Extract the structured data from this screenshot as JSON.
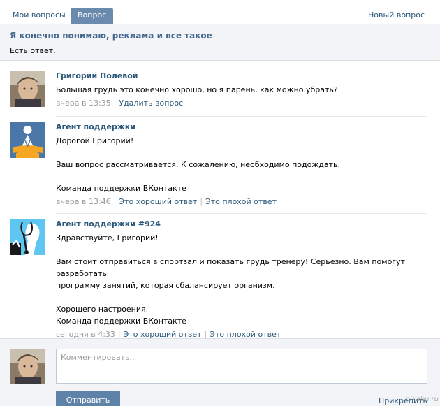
{
  "tabs": {
    "my_questions": "Мои вопросы",
    "question": "Вопрос",
    "new_question": "Новый вопрос"
  },
  "question": {
    "title": "Я конечно понимаю, реклама и все такое",
    "status": "Есть ответ."
  },
  "posts": [
    {
      "author": "Григорий Полевой",
      "lines": [
        "Большая грудь это конечно хорошо, но я парень, как можно убрать?"
      ],
      "time": "вчера в 13:35",
      "actions": [
        "Удалить вопрос"
      ]
    },
    {
      "author": "Агент поддержки",
      "lines": [
        "Дорогой Григорий!",
        "",
        "Ваш вопрос рассматривается. К сожалению, необходимо подождать.",
        "",
        "Команда поддержки ВКонтакте"
      ],
      "time": "вчера в 13:46",
      "actions": [
        "Это хороший ответ",
        "Это плохой ответ"
      ]
    },
    {
      "author": "Агент поддержки #924",
      "lines": [
        "Здравствуйте, Григорий!",
        "",
        "Вам стоит отправиться в спортзал и показать грудь тренеру! Серьёзно. Вам помогут разработать",
        "программу занятий, которая сбалансирует организм.",
        "",
        "Хорошего настроения,",
        "Команда поддержки ВКонтакте"
      ],
      "time": "сегодня в 4:33",
      "actions": [
        "Это хороший ответ",
        "Это плохой ответ"
      ]
    }
  ],
  "comment": {
    "placeholder": "Комментировать..",
    "send_label": "Отправить",
    "attach_label": "Прикрепить",
    "watermark": "pikabu.ru"
  }
}
